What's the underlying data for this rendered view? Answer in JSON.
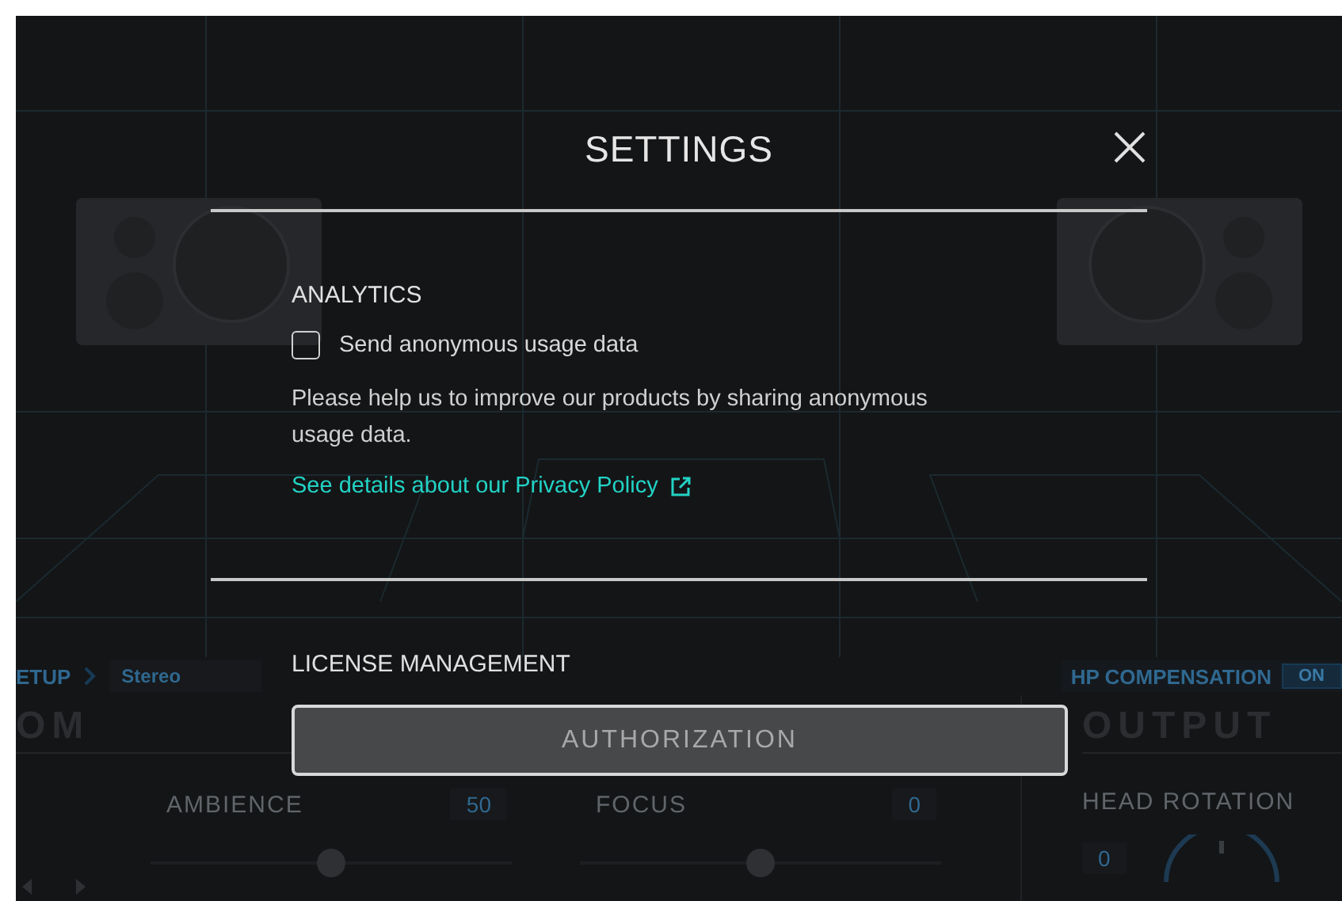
{
  "background_app": {
    "setup_label": "ETUP",
    "mode": "Stereo",
    "hp_compensation": {
      "label": "HP COMPENSATION",
      "toggle": "ON",
      "on": true
    },
    "room_title": "OM",
    "output_title": "OUTPUT",
    "controls": [
      {
        "label": "AMBIENCE",
        "value": "50",
        "level": 0.5
      },
      {
        "label": "FOCUS",
        "value": "0",
        "level": 0.5
      }
    ],
    "head_rotation": {
      "label": "HEAD ROTATION",
      "value": "0"
    }
  },
  "settings": {
    "title": "SETTINGS",
    "sections": [
      {
        "kind": "analytics",
        "heading": "ANALYTICS",
        "checkbox": {
          "label": "Send anonymous usage data",
          "checked": false
        },
        "description": "Please help us to improve our products by sharing anonymous usage data.",
        "link": "See details about our Privacy Policy"
      },
      {
        "kind": "license",
        "heading": "LICENSE MANAGEMENT",
        "button": "AUTHORIZATION"
      }
    ]
  }
}
